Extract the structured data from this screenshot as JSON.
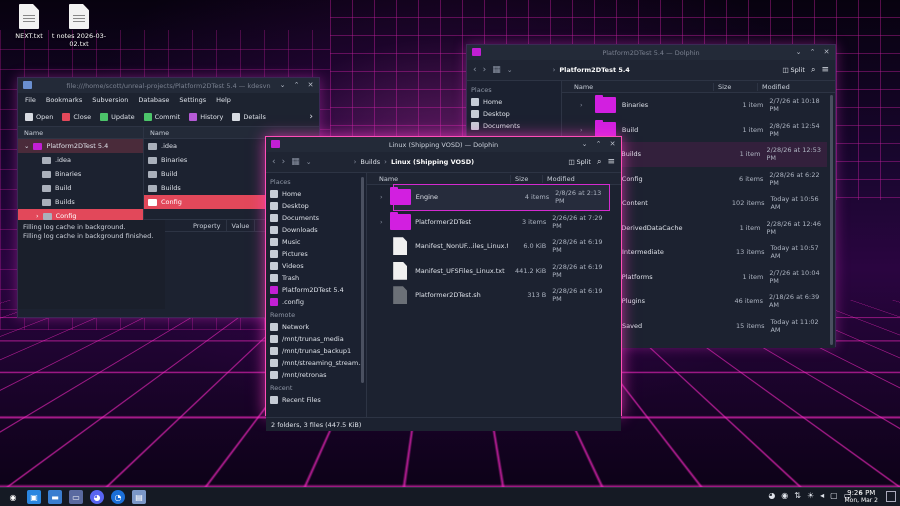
{
  "desktop": {
    "icons": [
      {
        "label": "NEXT.txt"
      },
      {
        "label": "t notes 2026-03-02.txt"
      }
    ]
  },
  "svn_window": {
    "title": "file:///home/scott/unreal-projects/Platform2DTest 5.4 — kdesvn",
    "menu": [
      "File",
      "Bookmarks",
      "Subversion",
      "Database",
      "Settings",
      "Help"
    ],
    "toolbar": [
      "Open",
      "Close",
      "Update",
      "Commit",
      "History",
      "Details"
    ],
    "tree_header": "Name",
    "tree": [
      {
        "label": "Platform2DTest 5.4",
        "state": "sel2"
      },
      {
        "label": ".idea"
      },
      {
        "label": "Binaries"
      },
      {
        "label": "Build"
      },
      {
        "label": "Builds"
      },
      {
        "label": "Config",
        "state": "sel"
      }
    ],
    "list_header": "Name",
    "list": [
      ".idea",
      "Binaries",
      "Build",
      "Builds",
      "Config"
    ],
    "log": [
      "Filling log cache in background.",
      "Filling log cache in background finished."
    ],
    "prop_headers": [
      "Property",
      "Value"
    ]
  },
  "dolphin_front": {
    "title": "Linux (Shipping VOSD) — Dolphin",
    "breadcrumb": [
      "Builds",
      "Linux (Shipping VOSD)"
    ],
    "split_label": "Split",
    "places_sections": {
      "places": "Places",
      "remote": "Remote",
      "recent": "Recent"
    },
    "places": [
      "Home",
      "Desktop",
      "Documents",
      "Downloads",
      "Music",
      "Pictures",
      "Videos",
      "Trash",
      "Platform2DTest 5.4",
      ".config"
    ],
    "remote": [
      "Network",
      "/mnt/trunas_media",
      "/mnt/trunas_backup1",
      "/mnt/streaming_stream...",
      "/mnt/retronas"
    ],
    "recent": [
      "Recent Files"
    ],
    "columns": {
      "name": "Name",
      "size": "Size",
      "modified": "Modified"
    },
    "files": [
      {
        "name": "Engine",
        "size": "4 items",
        "modified": "2/8/26 at 2:13 PM",
        "type": "folder",
        "selected": true
      },
      {
        "name": "Platformer2DTest",
        "size": "3 items",
        "modified": "2/26/26 at 7:29 PM",
        "type": "folder"
      },
      {
        "name": "Manifest_NonUF...iles_Linux.txt",
        "size": "6.0 KiB",
        "modified": "2/28/26 at 6:19 PM",
        "type": "doc"
      },
      {
        "name": "Manifest_UFSFiles_Linux.txt",
        "size": "441.2 KiB",
        "modified": "2/28/26 at 6:19 PM",
        "type": "doc"
      },
      {
        "name": "Platformer2DTest.sh",
        "size": "313 B",
        "modified": "2/28/26 at 6:19 PM",
        "type": "sh"
      }
    ],
    "status": "2 folders, 3 files (447.5 KiB)"
  },
  "dolphin_back": {
    "title": "Platform2DTest 5.4 — Dolphin",
    "breadcrumb": [
      "Platform2DTest 5.4"
    ],
    "split_label": "Split",
    "places_section": "Places",
    "places": [
      "Home",
      "Desktop",
      "Documents"
    ],
    "columns": {
      "name": "Name",
      "size": "Size",
      "modified": "Modified"
    },
    "files": [
      {
        "name": "Binaries",
        "size": "1 item",
        "modified": "2/7/26 at 10:18 PM",
        "expandable": true
      },
      {
        "name": "Build",
        "size": "1 item",
        "modified": "2/8/26 at 12:54 PM",
        "expandable": true
      },
      {
        "name": "Builds",
        "size": "1 item",
        "modified": "2/28/26 at 12:53 PM",
        "highlight": true
      },
      {
        "name": "Config",
        "size": "6 items",
        "modified": "2/28/26 at 6:22 PM"
      },
      {
        "name": "Content",
        "size": "102 items",
        "modified": "Today at 10:56 AM"
      },
      {
        "name": "DerivedDataCache",
        "size": "1 item",
        "modified": "2/28/26 at 12:46 PM"
      },
      {
        "name": "Intermediate",
        "size": "13 items",
        "modified": "Today at 10:57 AM"
      },
      {
        "name": "Platforms",
        "size": "1 item",
        "modified": "2/7/26 at 10:04 PM"
      },
      {
        "name": "Plugins",
        "size": "46 items",
        "modified": "2/18/26 at 6:39 AM"
      },
      {
        "name": "Saved",
        "size": "15 items",
        "modified": "Today at 11:02 AM"
      }
    ]
  },
  "taskbar": {
    "apps": [
      "start-menu",
      "discover",
      "dolphin",
      "kdesvn-files",
      "discord",
      "steam-client",
      "kdesvn"
    ],
    "time": "9:26 PM",
    "date": "Mon, Mar 2"
  }
}
